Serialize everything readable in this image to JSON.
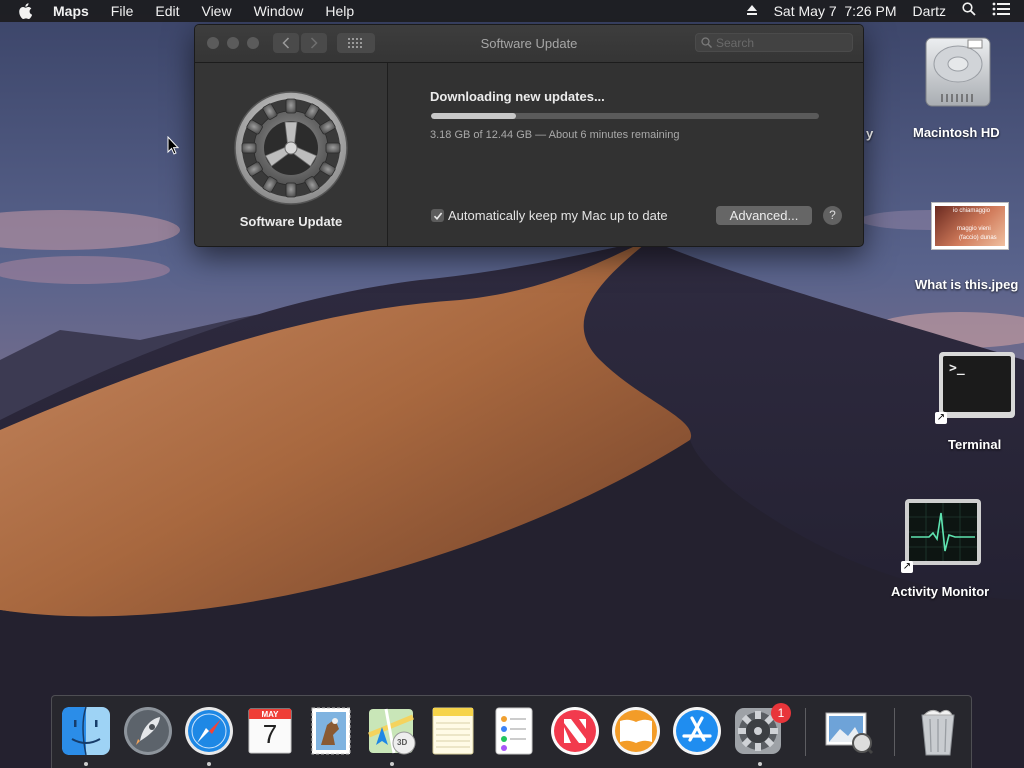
{
  "menubar": {
    "app_name": "Maps",
    "items": [
      "File",
      "Edit",
      "View",
      "Window",
      "Help"
    ],
    "date_time": "Sat May 7  7:26 PM",
    "user": "Dartz"
  },
  "window": {
    "title": "Software Update",
    "search_placeholder": "Search",
    "sidebar_label": "Software Update",
    "status_title": "Downloading new updates...",
    "progress_fraction": 0.22,
    "progress_detail": "3.18 GB of 12.44 GB — About 6 minutes remaining",
    "auto_update_label": "Automatically keep my Mac up to date",
    "auto_update_checked": true,
    "advanced_label": "Advanced...",
    "help_label": "?"
  },
  "desktop": {
    "partial_label": "y",
    "icons": [
      {
        "label": "Macintosh HD"
      },
      {
        "label": "What is this.jpeg",
        "thumb_line1": "io chiamaggio",
        "thumb_line2": "maggio vieni",
        "thumb_line3": "(faccio) dunas"
      },
      {
        "label": "Terminal",
        "prompt": ">_"
      },
      {
        "label": "Activity Monitor"
      }
    ]
  },
  "dock": {
    "items": [
      "finder",
      "launchpad",
      "safari",
      "calendar",
      "mail",
      "maps",
      "notes",
      "reminders",
      "news",
      "books",
      "app-store",
      "system-preferences",
      "preview",
      "trash"
    ],
    "calendar_month": "MAY",
    "calendar_day": "7",
    "badge_count": "1",
    "maps_label": "3D"
  },
  "colors": {
    "window_bg": "#323232",
    "badge_red": "#e8353a",
    "accent_blue": "#1e88e5"
  }
}
